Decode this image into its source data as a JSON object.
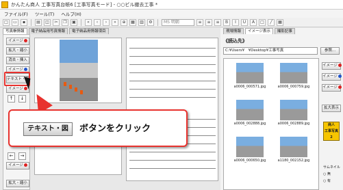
{
  "window": {
    "title": "かんたん商人 工事写真台帳6 [工事写真モード] - ○○ビル撤去工事 *"
  },
  "menu": [
    "ファイル(F)",
    "ツール(T)",
    "ヘルプ(H)"
  ],
  "toolbar": {
    "font_name": "MS 明朝"
  },
  "left_tabs": [
    "写真帳情報",
    "電子納品用写真情報",
    "電子納品用情報項目"
  ],
  "left_buttons": {
    "image_label": "イメージ",
    "enlarge": "拡大・縮小",
    "remove_insert": "消去・挿入",
    "image_label2": "イメージ",
    "text_fig": "テキスト・図",
    "image_label3": "イメージ",
    "up": "↑",
    "down": "↓",
    "left": "←",
    "right": "→",
    "enlarge2": "拡大・縮小",
    "bottom_label": "拡大・縮小"
  },
  "right_tabs": [
    "現場情報",
    "イメージ表示",
    "撮影記事"
  ],
  "right_panel": {
    "section_title": "《読込先》",
    "path": "C:¥Users¥　¥Desktop¥工事写真",
    "browse_label": "参照...",
    "image_buttons": [
      "イメージ",
      "イメージ",
      "イメージ"
    ],
    "enlarge_display": "拡大表示",
    "badge_line1": "商人",
    "badge_line2": "工事写真",
    "badge_number": "2",
    "sample_label": "サムネイル",
    "radio_none": "無",
    "radio_yes": "有"
  },
  "thumbnails": [
    "a0006_000571.jpg",
    "a0006_000759.jpg",
    "a0006_002888.jpg",
    "a0006_002889.jpg",
    "a0006_000650.jpg",
    "a1180_002152.jpg"
  ],
  "callout": {
    "button_label": "テキスト・図",
    "text": "ボタンをクリック"
  },
  "colors": {
    "accent_red": "#e8322e",
    "badge_yellow": "#f6c500"
  }
}
